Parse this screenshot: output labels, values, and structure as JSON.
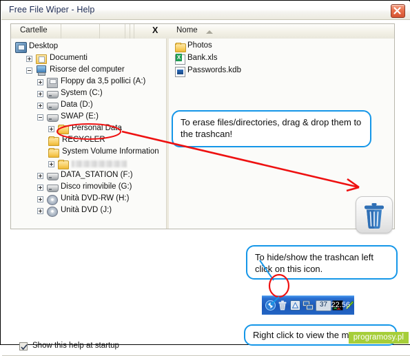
{
  "window": {
    "title": "Free File Wiper - Help",
    "close_label": "x"
  },
  "explorer": {
    "folders_tab": "Cartelle",
    "close_panel_label": "X",
    "name_column": "Nome",
    "tree": [
      {
        "label": "Desktop",
        "icon": "desktop-icon",
        "indent": 0,
        "toggle": "none"
      },
      {
        "label": "Documenti",
        "icon": "documents-folder-icon",
        "indent": 1,
        "toggle": "plus"
      },
      {
        "label": "Risorse del computer",
        "icon": "my-computer-icon",
        "indent": 1,
        "toggle": "minus"
      },
      {
        "label": "Floppy da 3,5 pollici (A:)",
        "icon": "floppy-drive-icon",
        "indent": 2,
        "toggle": "plus"
      },
      {
        "label": "System (C:)",
        "icon": "hard-drive-icon",
        "indent": 2,
        "toggle": "plus"
      },
      {
        "label": "Data (D:)",
        "icon": "hard-drive-icon",
        "indent": 2,
        "toggle": "plus"
      },
      {
        "label": "SWAP (E:)",
        "icon": "hard-drive-icon",
        "indent": 2,
        "toggle": "minus"
      },
      {
        "label": "Personal Data",
        "icon": "folder-icon",
        "indent": 3,
        "toggle": "plus"
      },
      {
        "label": "RECYCLER",
        "icon": "folder-icon",
        "indent": 3,
        "toggle": "none"
      },
      {
        "label": "System Volume Information",
        "icon": "folder-icon",
        "indent": 3,
        "toggle": "none"
      },
      {
        "label": "",
        "icon": "folder-icon",
        "indent": 3,
        "toggle": "plus"
      },
      {
        "label": "DATA_STATION (F:)",
        "icon": "hard-drive-icon",
        "indent": 2,
        "toggle": "plus"
      },
      {
        "label": "Disco rimovibile (G:)",
        "icon": "hard-drive-icon",
        "indent": 2,
        "toggle": "plus"
      },
      {
        "label": "Unità DVD-RW (H:)",
        "icon": "dvd-drive-icon",
        "indent": 2,
        "toggle": "plus"
      },
      {
        "label": "Unità DVD (J:)",
        "icon": "dvd-drive-icon",
        "indent": 2,
        "toggle": "plus"
      }
    ],
    "files": [
      {
        "label": "Photos",
        "icon": "folder-icon"
      },
      {
        "label": "Bank.xls",
        "icon": "excel-file-icon"
      },
      {
        "label": "Passwords.kdb",
        "icon": "keepass-file-icon"
      }
    ]
  },
  "callouts": {
    "erase": "To erase files/directories, drag & drop them to the trashcan!",
    "hide_show": "To hide/show the trashcan left click on this icon.",
    "right_click": "Right click to view the menu."
  },
  "tray": {
    "clock": "22.56",
    "counter": "37",
    "icons": [
      "recycle-arrows-icon",
      "trashcan-tray-icon",
      "warning-triangle-icon",
      "network-icon",
      "counter-badge",
      "black-square-icon",
      "pencil-icon"
    ]
  },
  "footer": {
    "show_help_label": "Show this help at startup",
    "show_help_checked": true
  },
  "watermark": "programosy.pl",
  "colors": {
    "callout_border": "#1496e8",
    "arrow_red": "#ee1111",
    "accent_title": "#1d2b53",
    "tray_blue": "#1c58b8",
    "watermark_green": "#a6ce39",
    "trash_blue": "#2f6fb5"
  }
}
